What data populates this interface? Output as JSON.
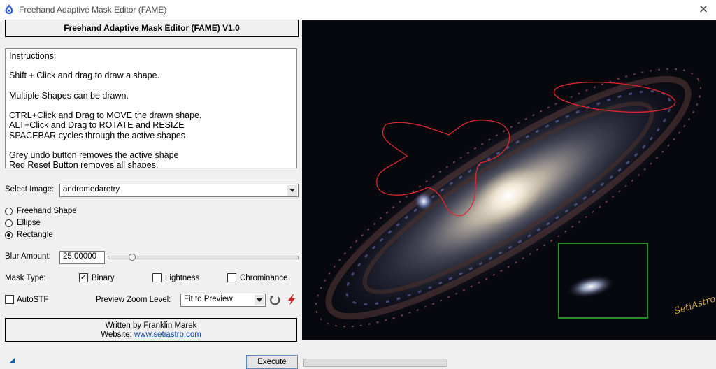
{
  "window": {
    "title": "Freehand Adaptive Mask Editor (FAME)",
    "close_glyph": "✕"
  },
  "header": {
    "title": "Freehand Adaptive Mask Editor (FAME) V1.0"
  },
  "instructions": {
    "text": "Instructions:\n\nShift + Click and drag to draw a shape.\n\nMultiple Shapes can be drawn.\n\nCTRL+Click and Drag to MOVE the drawn shape.\nALT+Click and Drag to ROTATE and RESIZE\nSPACEBAR cycles through the active shapes\n\nGrey undo button removes the active shape\nRed Reset Button removes all shapes."
  },
  "select_image": {
    "label": "Select Image:",
    "value": "andromedaretry"
  },
  "shape_options": [
    {
      "label": "Freehand Shape",
      "selected": false
    },
    {
      "label": "Ellipse",
      "selected": false
    },
    {
      "label": "Rectangle",
      "selected": true
    }
  ],
  "blur": {
    "label": "Blur Amount:",
    "value": "25.00000",
    "slider_fraction": 0.13
  },
  "mask_type": {
    "label": "Mask Type:",
    "options": [
      {
        "label": "Binary",
        "checked": true
      },
      {
        "label": "Lightness",
        "checked": false
      },
      {
        "label": "Chrominance",
        "checked": false
      }
    ]
  },
  "autostf": {
    "label": "AutoSTF",
    "checked": false
  },
  "zoom": {
    "label": "Preview Zoom Level:",
    "value": "Fit to Preview"
  },
  "credits": {
    "line1": "Written by Franklin Marek",
    "website_label": "Website:",
    "website": "www.setiastro.com"
  },
  "execute": {
    "label": "Execute"
  },
  "preview": {
    "signature": "SetiAstro",
    "shape_colors": {
      "freehand": "#e0262b",
      "ellipse": "#e0262b",
      "rectangle": "#3ad43a"
    }
  },
  "icons": {
    "undo": "undo-icon",
    "reset": "reset-lightning-icon",
    "app": "app-logo-icon",
    "corner": "resize-corner-icon"
  }
}
